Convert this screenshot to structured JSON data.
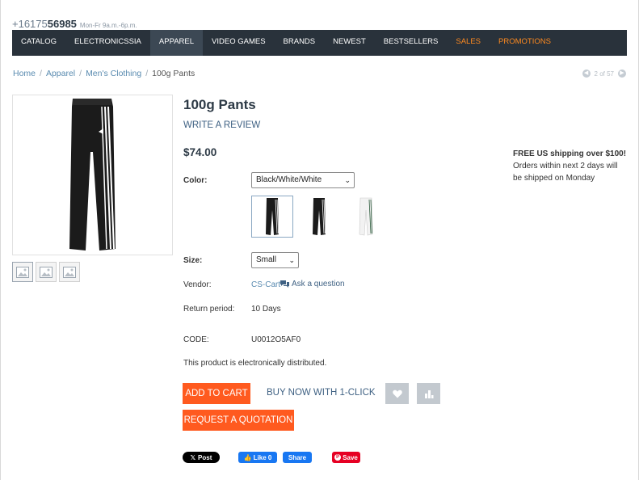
{
  "header": {
    "phone_prefix": "+16175",
    "phone_bold": "56985",
    "hours": "Mon-Fr 9a.m.-6p.m."
  },
  "nav": {
    "items": [
      {
        "label": "CATALOG"
      },
      {
        "label": "ELECTRONICSSIA"
      },
      {
        "label": "APPAREL"
      },
      {
        "label": "VIDEO GAMES"
      },
      {
        "label": "BRANDS"
      },
      {
        "label": "NEWEST"
      },
      {
        "label": "BESTSELLERS"
      },
      {
        "label": "SALES"
      },
      {
        "label": "PROMOTIONS"
      }
    ],
    "active": "APPAREL",
    "accent_color": "#ff8a1f",
    "bar_color": "#29323b"
  },
  "breadcrumb": {
    "home": "Home",
    "apparel": "Apparel",
    "mens": "Men's Clothing",
    "current": "100g Pants"
  },
  "pager": {
    "text": "2 of 57"
  },
  "product": {
    "title": "100g Pants",
    "write_review": "WRITE A REVIEW",
    "price": "$74.00",
    "color_label": "Color:",
    "color_value": "Black/White/White",
    "size_label": "Size:",
    "size_value": "Small",
    "vendor_label": "Vendor:",
    "vendor_value": "CS-Cart",
    "ask_question": "Ask a question",
    "return_label": "Return period:",
    "return_value": "10 Days",
    "code_label": "CODE:",
    "code_value": "U0012O5AF0",
    "distribution_note": "This product is electronically distributed."
  },
  "shipping": {
    "headline": "FREE US shipping over $100!",
    "line1": "Orders within next 2 days will",
    "line2": "be shipped on Monday"
  },
  "actions": {
    "add_to_cart": "ADD TO CART",
    "buy_now": "BUY NOW WITH 1-CLICK",
    "request_quote": "REQUEST A QUOTATION",
    "button_color": "#ff5a1f"
  },
  "social": {
    "tweet": "Post",
    "like": "Like 0",
    "share": "Share",
    "save": "Save"
  }
}
